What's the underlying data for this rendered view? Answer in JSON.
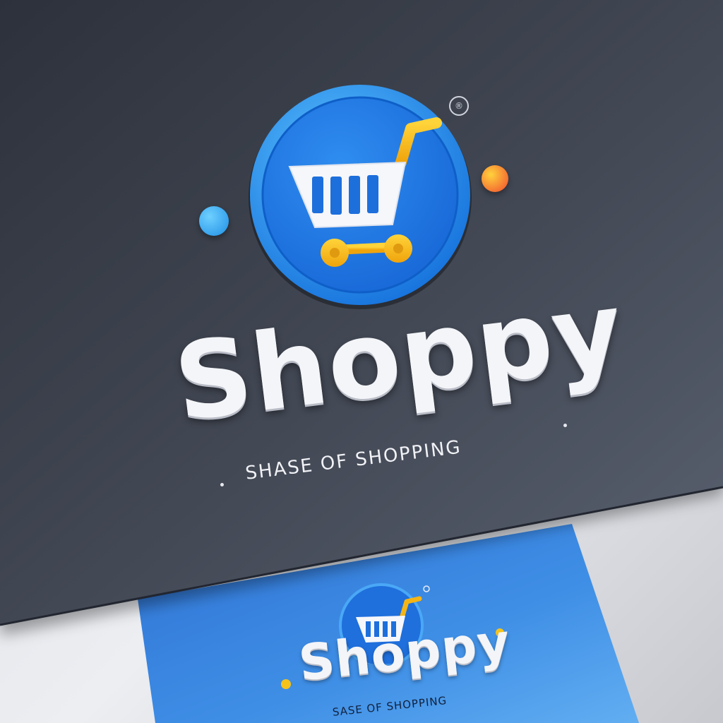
{
  "brand": {
    "name": "Shoppy",
    "tagline": "SHASE OF SHOPPING",
    "registered_mark": "®"
  },
  "small_card": {
    "name": "Shoppy",
    "tagline": "SASE OF SHOPPING"
  },
  "icons": [
    "shopping-cart-icon",
    "registered-trademark-icon"
  ],
  "colors": {
    "dark_card": "#3c414d",
    "blue_card": "#3f8fe6",
    "logo_circle": "#1f7fe8",
    "cart_white": "#f5f7fb",
    "wheels_yellow": "#f5b515",
    "accent_orange": "#f26a2e",
    "accent_blue_dot": "#2ea6f0"
  }
}
